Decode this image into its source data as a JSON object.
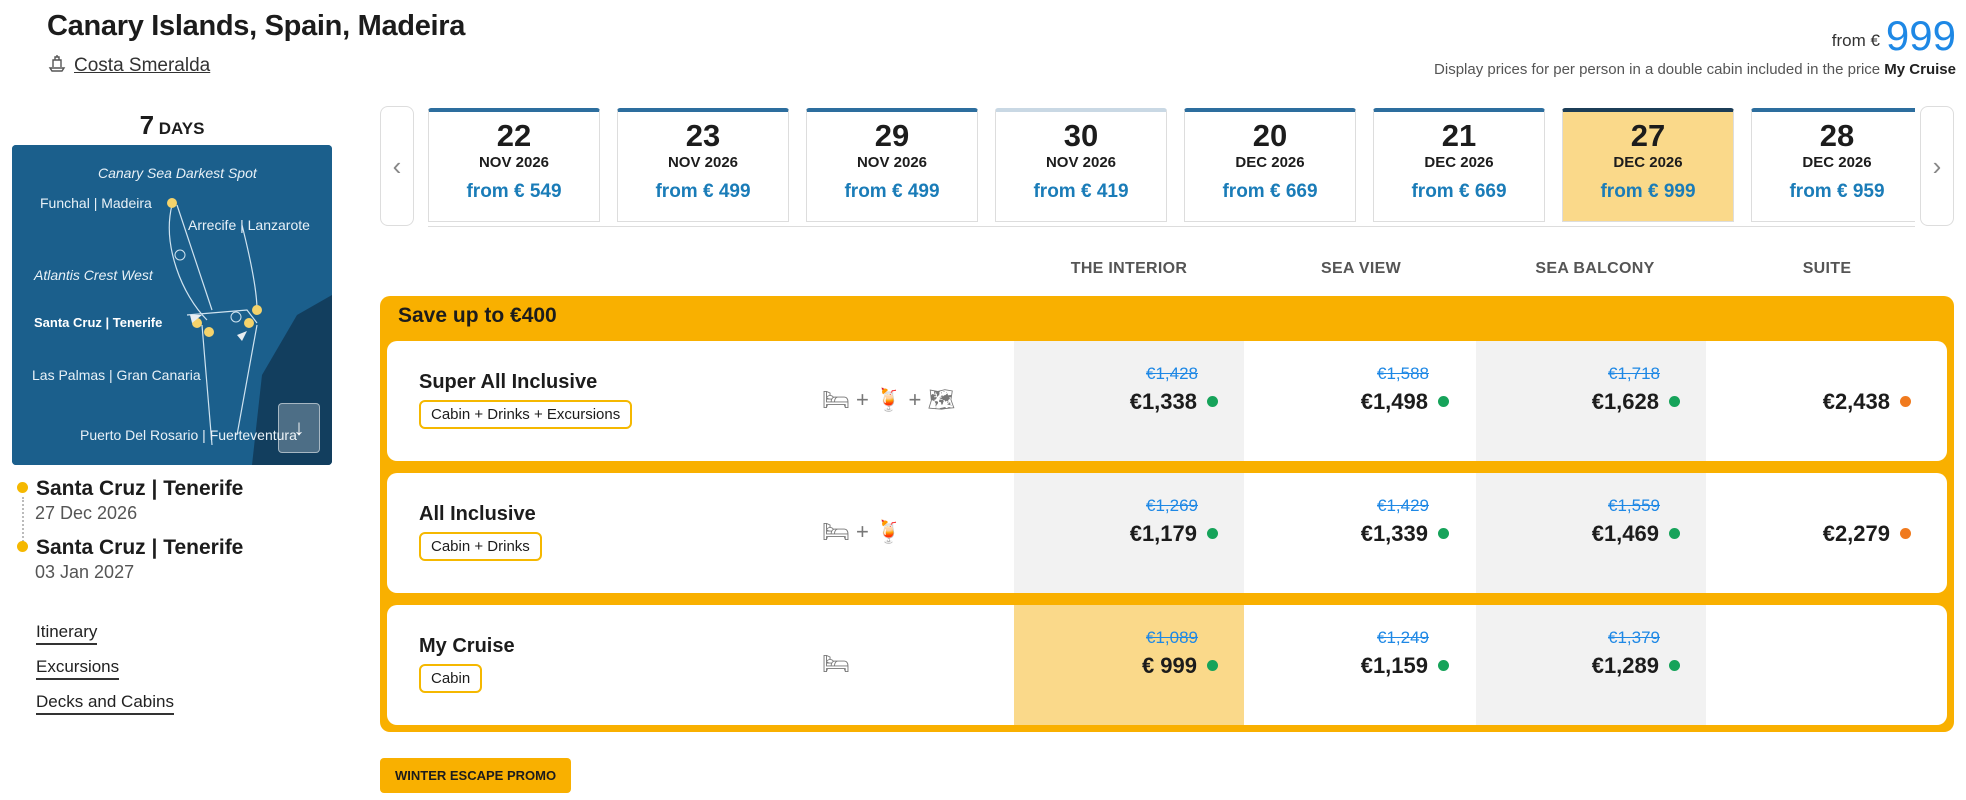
{
  "header": {
    "title": "Canary Islands, Spain, Madeira",
    "ship": "Costa Smeralda",
    "from_label": "from €",
    "from_price": "999",
    "display_note_prefix": "Display prices for per person in a double cabin included in the price ",
    "display_note_bold": "My Cruise"
  },
  "sidebar": {
    "days_number": "7",
    "days_label": "DAYS",
    "map_labels": {
      "sea_spot": "Canary Sea Darkest Spot",
      "funchal": "Funchal | Madeira",
      "arrecife": "Arrecife | Lanzarote",
      "atlantis": "Atlantis Crest West",
      "santa_cruz": "Santa Cruz | Tenerife",
      "las_palmas": "Las Palmas | Gran Canaria",
      "puerto": "Puerto Del Rosario | Fuerteventura"
    },
    "departure": {
      "port": "Santa Cruz | Tenerife",
      "date": "27 Dec 2026"
    },
    "arrival": {
      "port": "Santa Cruz | Tenerife",
      "date": "03 Jan 2027"
    },
    "links": [
      "Itinerary",
      "Excursions",
      "Decks and Cabins"
    ]
  },
  "dates": [
    {
      "day": "22",
      "month": "NOV 2026",
      "price": "from € 549"
    },
    {
      "day": "23",
      "month": "NOV 2026",
      "price": "from € 499"
    },
    {
      "day": "29",
      "month": "NOV 2026",
      "price": "from € 499"
    },
    {
      "day": "30",
      "month": "NOV 2026",
      "price": "from € 419"
    },
    {
      "day": "20",
      "month": "DEC 2026",
      "price": "from € 669"
    },
    {
      "day": "21",
      "month": "DEC 2026",
      "price": "from € 669"
    },
    {
      "day": "27",
      "month": "DEC 2026",
      "price": "from € 999",
      "selected": true
    },
    {
      "day": "28",
      "month": "DEC 2026",
      "price": "from € 959"
    }
  ],
  "columns": [
    "THE INTERIOR",
    "SEA VIEW",
    "SEA BALCONY",
    "SUITE"
  ],
  "promo": {
    "save_label": "Save up to €400"
  },
  "packages": [
    {
      "name": "Super All Inclusive",
      "tag": "Cabin + Drinks + Excursions",
      "icons": [
        "bed-icon",
        "drinks-icon",
        "map-icon"
      ],
      "prices": [
        {
          "old": "€1,428",
          "new": "€1,338",
          "status": "green"
        },
        {
          "old": "€1,588",
          "new": "€1,498",
          "status": "green"
        },
        {
          "old": "€1,718",
          "new": "€1,628",
          "status": "green"
        },
        {
          "old": "",
          "new": "€2,438",
          "status": "orange"
        }
      ]
    },
    {
      "name": "All Inclusive",
      "tag": "Cabin + Drinks",
      "icons": [
        "bed-icon",
        "drinks-icon"
      ],
      "prices": [
        {
          "old": "€1,269",
          "new": "€1,179",
          "status": "green"
        },
        {
          "old": "€1,429",
          "new": "€1,339",
          "status": "green"
        },
        {
          "old": "€1,559",
          "new": "€1,469",
          "status": "green"
        },
        {
          "old": "",
          "new": "€2,279",
          "status": "orange"
        }
      ]
    },
    {
      "name": "My Cruise",
      "tag": "Cabin",
      "icons": [
        "bed-icon"
      ],
      "prices": [
        {
          "old": "€1,089",
          "new": "€ 999",
          "status": "green"
        },
        {
          "old": "€1,249",
          "new": "€1,159",
          "status": "green"
        },
        {
          "old": "€1,379",
          "new": "€1,289",
          "status": "green"
        },
        {
          "old": "",
          "new": "",
          "status": ""
        }
      ]
    }
  ],
  "winter_promo": "WINTER ESCAPE PROMO",
  "colors": {
    "accent": "#f9b000",
    "link_blue": "#1e88e5",
    "selected": "#fad98a",
    "green": "#16a35a",
    "orange": "#f07a1e"
  }
}
